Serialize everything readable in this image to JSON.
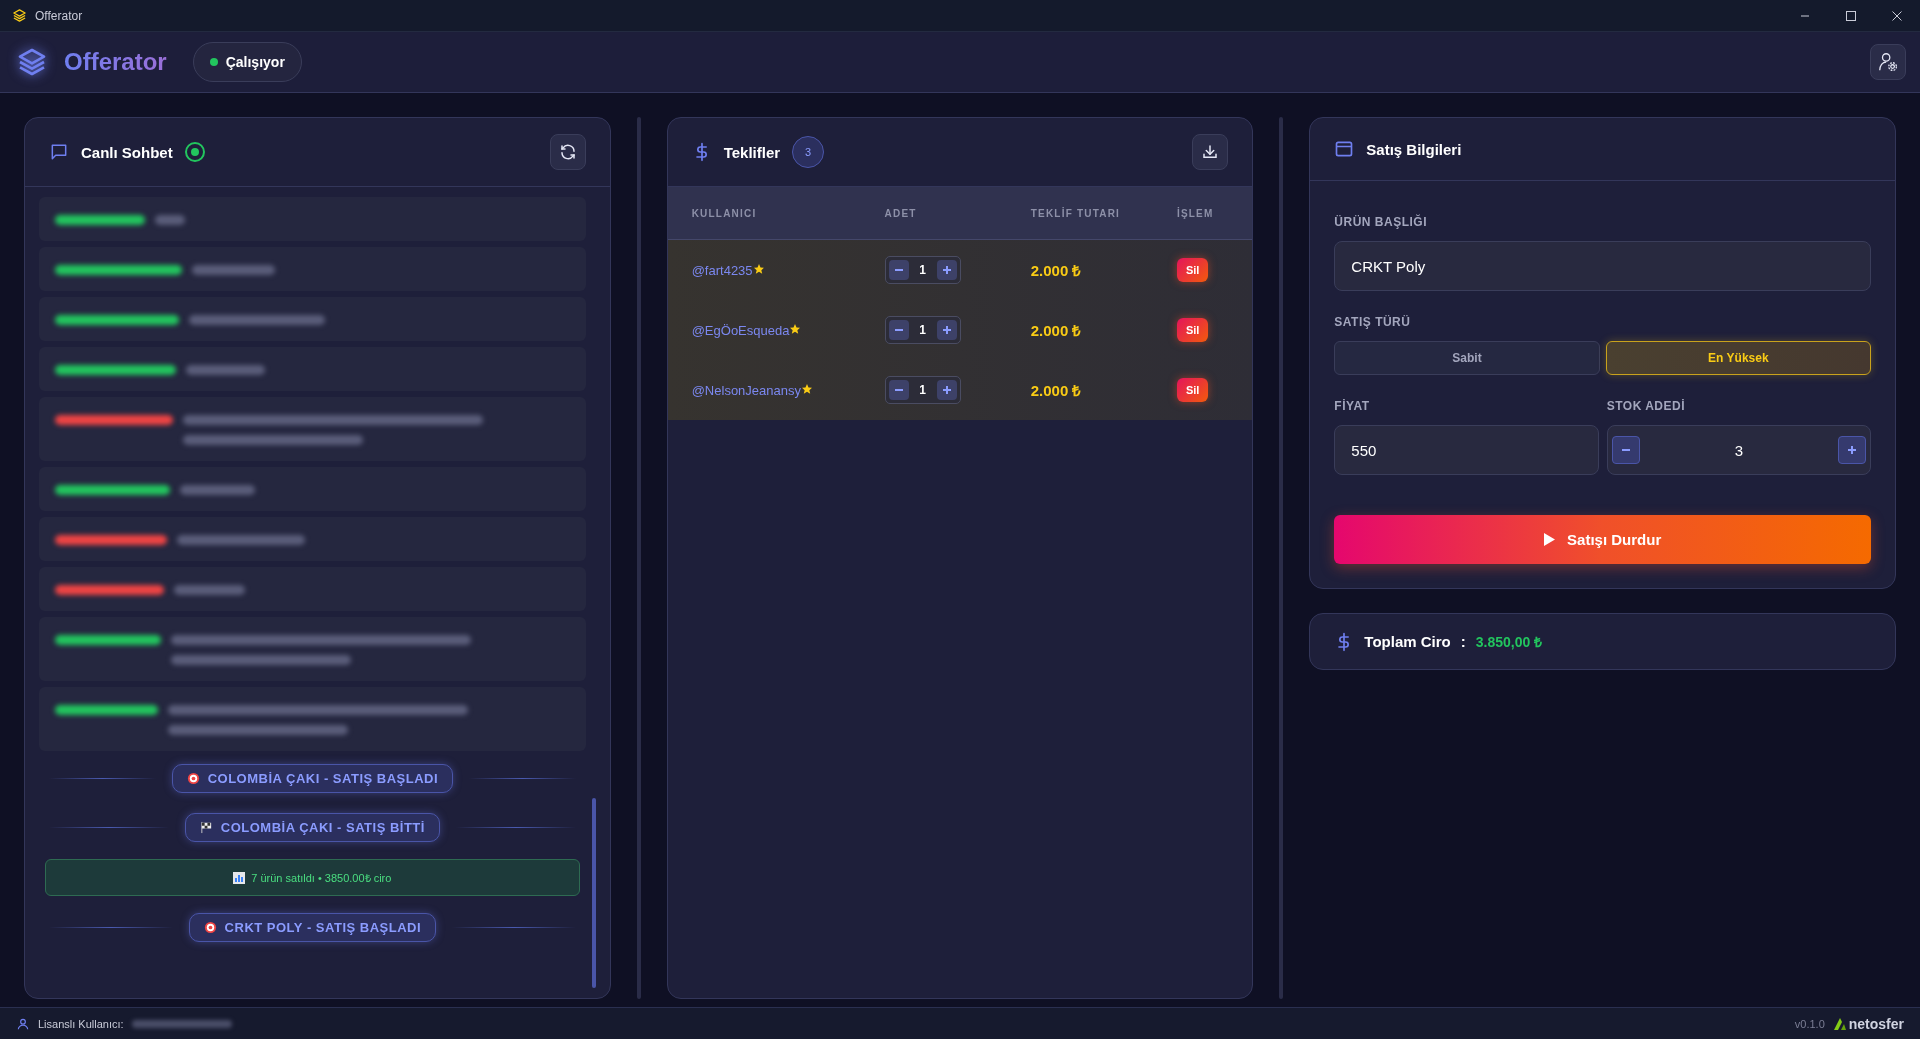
{
  "window": {
    "title": "Offerator"
  },
  "header": {
    "app_name": "Offerator",
    "status": {
      "label": "Çalışıyor",
      "on": true
    }
  },
  "chat": {
    "title": "Canlı Sohbet",
    "live": true,
    "messages": [
      {
        "color": "#22c55e",
        "kind": "short"
      },
      {
        "color": "#22c55e",
        "kind": "short"
      },
      {
        "color": "#22c55e",
        "kind": "short"
      },
      {
        "color": "#22c55e",
        "kind": "short"
      },
      {
        "color": "#ef4444",
        "kind": "long"
      },
      {
        "color": "#22c55e",
        "kind": "short"
      },
      {
        "color": "#ef4444",
        "kind": "short"
      },
      {
        "color": "#ef4444",
        "kind": "short"
      },
      {
        "color": "#22c55e",
        "kind": "long"
      },
      {
        "color": "#22c55e",
        "kind": "long"
      }
    ],
    "events": [
      {
        "kind": "start",
        "text": "COLOMBİA ÇAKI - SATIŞ BAŞLADI"
      },
      {
        "kind": "end",
        "text": "COLOMBİA ÇAKI - SATIŞ BİTTİ"
      },
      {
        "kind": "summary",
        "text": "7 ürün satıldı • 3850.00₺ ciro"
      },
      {
        "kind": "start",
        "text": "CRKT POLY - SATIŞ BAŞLADI"
      }
    ]
  },
  "offers": {
    "title": "Teklifler",
    "count": "3",
    "columns": [
      "KULLANICI",
      "ADET",
      "TEKLİF TUTARI",
      "İŞLEM"
    ],
    "rows": [
      {
        "user": "@fart4235",
        "starred": true,
        "quantity": "1",
        "amount": "2.000 ₺",
        "action": "Sil"
      },
      {
        "user": "@EgÖoEsqueda",
        "starred": true,
        "quantity": "1",
        "amount": "2.000 ₺",
        "action": "Sil"
      },
      {
        "user": "@NelsonJeanansy",
        "starred": true,
        "quantity": "1",
        "amount": "2.000 ₺",
        "action": "Sil"
      }
    ]
  },
  "sale": {
    "title": "Satış Bilgileri",
    "product": {
      "label": "ÜRÜN BAŞLIĞI",
      "value": "CRKT Poly"
    },
    "sale_type": {
      "label": "SATIŞ TÜRÜ",
      "options": [
        {
          "label": "Sabit",
          "selected": false
        },
        {
          "label": "En Yüksek",
          "selected": true
        }
      ]
    },
    "price": {
      "label": "FİYAT",
      "value": "550"
    },
    "stock": {
      "label": "STOK ADEDİ",
      "value": "3"
    },
    "button": "Satışı Durdur"
  },
  "total": {
    "label": "Toplam Ciro",
    "separator": ":",
    "value": "3.850,00 ₺"
  },
  "status_bar": {
    "license_label": "Lisanslı Kullanıcı:",
    "version": "v0.1.0",
    "brand": "netosfer"
  }
}
